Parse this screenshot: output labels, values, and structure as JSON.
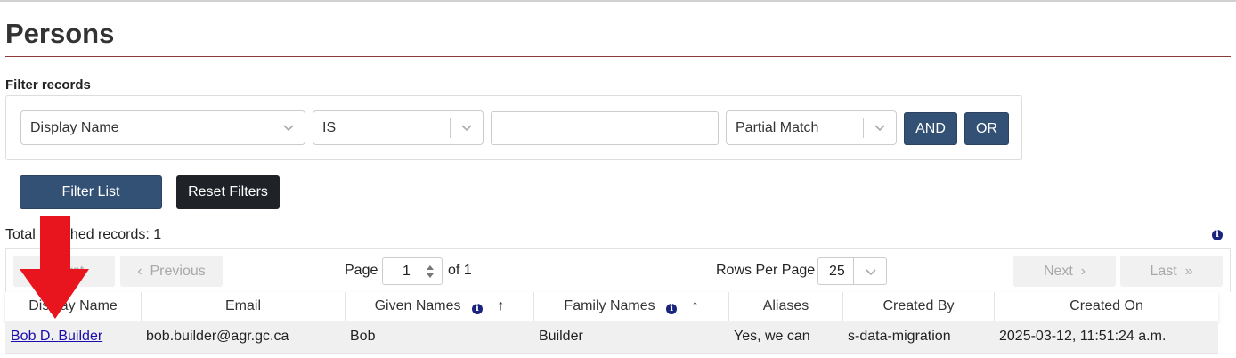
{
  "page": {
    "title": "Persons",
    "filter_label": "Filter records"
  },
  "filter": {
    "field_select": "Display Name",
    "operator_select": "IS",
    "value_input": "",
    "match_select": "Partial Match",
    "and_label": "AND",
    "or_label": "OR",
    "filter_list_label": "Filter List",
    "reset_label": "Reset Filters"
  },
  "results": {
    "total_text": "Total matched records: 1"
  },
  "pager": {
    "first_label": "First",
    "previous_label": "Previous",
    "page_label": "Page",
    "page_value": "1",
    "of_label": "of 1",
    "rows_label": "Rows Per Page",
    "rows_value": "25",
    "next_label": "Next",
    "last_label": "Last"
  },
  "table": {
    "columns": [
      "Display Name",
      "Email",
      "Given Names",
      "Family Names",
      "Aliases",
      "Created By",
      "Created On"
    ],
    "rows": [
      [
        "Bob D. Builder",
        "bob.builder@agr.gc.ca",
        "Bob",
        "Builder",
        "Yes, we can",
        "s-data-migration",
        "2025-03-12, 11:51:24 a.m."
      ]
    ]
  },
  "colors": {
    "primary_button": "#335075",
    "dark_button": "#1f2328",
    "title_rule": "#8a3b3b",
    "link": "#1a0dab",
    "annotation_arrow": "#e8141e"
  }
}
